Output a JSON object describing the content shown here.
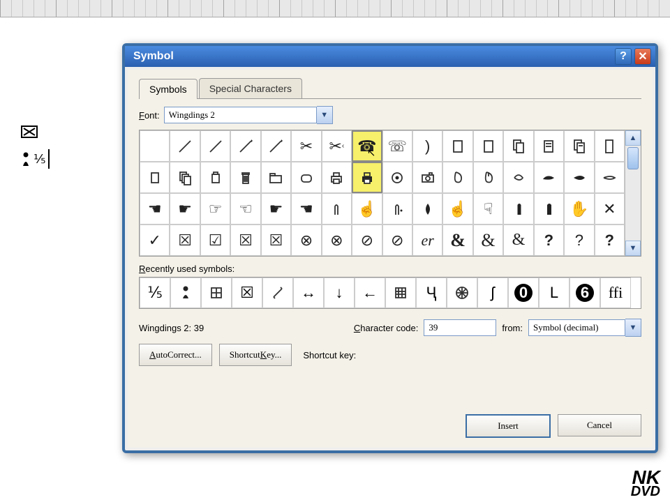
{
  "dialog": {
    "title": "Symbol",
    "tabs": [
      "Symbols",
      "Special Characters"
    ],
    "active_tab": 0,
    "font_label": "Font:",
    "font_value": "Wingdings 2",
    "recent_label": "Recently used symbols:",
    "status_text": "Wingdings 2: 39",
    "charcode_label": "Character code:",
    "charcode_value": "39",
    "from_label": "from:",
    "from_value": "Symbol (decimal)",
    "autocorrect_label": "AutoCorrect...",
    "shortcutkey_btn": "Shortcut Key...",
    "shortcutkey_label": "Shortcut key:",
    "insert_label": "Insert",
    "cancel_label": "Cancel"
  },
  "grid": {
    "selected_index": 7,
    "selected_below_index": 23,
    "glyphs": [
      " ",
      "pen",
      "pen",
      "pencil",
      "pencil",
      "scissor",
      "scissor-cut",
      "phone",
      "phone-b",
      "wave",
      "page",
      "page2",
      "copy",
      "doc",
      "docs",
      "doc-tall",
      "box",
      "copies",
      "box-open",
      "trash",
      "folder",
      "folder-round",
      "printer",
      "printer-b",
      "target",
      "camera",
      "mouse",
      "mouse-b",
      "hand-o",
      "hand-right",
      "hand-right-b",
      "hand-right-s",
      "point-l",
      "point-r",
      "point-r-o",
      "point-l-o",
      "point-r-s",
      "point-l-s",
      "hand-up",
      "hand-up-o",
      "hand-drip",
      "leaf",
      "hand-up-s",
      "hand-down",
      "finger",
      "finger-b",
      "palm",
      "x",
      "check",
      "boxed-x",
      "boxed-check",
      "boxed-x2",
      "boxed-x3",
      "circle-x",
      "circle-x-o",
      "noentry",
      "noentry-o",
      "er",
      "amp",
      "amp-b",
      "amp-c",
      "punct",
      "q",
      "qb"
    ]
  },
  "recent": [
    "1/5",
    "person",
    "window",
    "boxed-x",
    "ruler",
    "lr",
    "down",
    "left",
    "grid",
    "ru",
    "web",
    "hook",
    "zero",
    "L",
    "six",
    "ffi"
  ],
  "doc_lines": [
    "boxed-x",
    "person-1/5"
  ],
  "logo": {
    "top": "NK",
    "bot": "DVD"
  }
}
